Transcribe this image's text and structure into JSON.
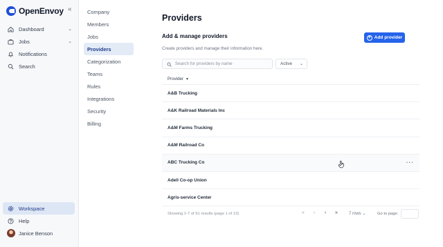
{
  "app": {
    "name": "OpenEnvoy"
  },
  "sidebar": {
    "items": [
      {
        "label": "Dashboard",
        "icon": "home-icon",
        "expandable": true
      },
      {
        "label": "Jobs",
        "icon": "briefcase-icon",
        "expandable": true
      },
      {
        "label": "Notifications",
        "icon": "bell-icon",
        "expandable": false
      },
      {
        "label": "Search",
        "icon": "search-icon",
        "expandable": false
      }
    ],
    "bottom": [
      {
        "label": "Workspace",
        "icon": "gear-icon",
        "active": true
      },
      {
        "label": "Help",
        "icon": "help-icon",
        "active": false
      }
    ],
    "user": {
      "name": "Janice Benson"
    }
  },
  "settings_nav": {
    "items": [
      "Company",
      "Members",
      "Jobs",
      "Providers",
      "Categorization",
      "Teams",
      "Rules",
      "Integrations",
      "Security",
      "Billing"
    ],
    "active": "Providers"
  },
  "main": {
    "title": "Providers",
    "section_title": "Add & manage providers",
    "section_desc": "Create providers and manage their information here.",
    "add_button": "Add provider",
    "search_placeholder": "Search for providers by name",
    "status_filter": "Active",
    "table": {
      "column": "Provider",
      "rows": [
        "A&B Trucking",
        "A&K Railroad Materials Inc",
        "A&M Farms Trucking",
        "A&M Railroad Co",
        "ABC Trucking Co",
        "Adell Co-op Union",
        "Agris-service Center"
      ]
    },
    "footer": {
      "showing": "Showing 1-7 of 91 results (page 1 of 13)",
      "rows_per_page": "7 rows",
      "go_to_page_label": "Go to page:"
    }
  },
  "colors": {
    "accent": "#2563eb",
    "active_bg": "#dde6f4"
  }
}
